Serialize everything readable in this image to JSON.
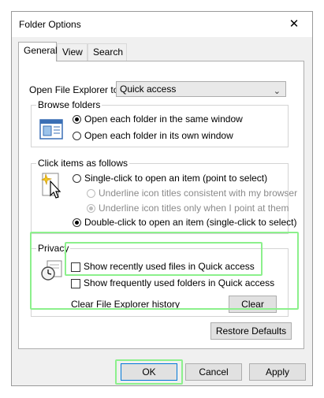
{
  "window": {
    "title": "Folder Options",
    "close_glyph": "✕"
  },
  "tabs": [
    {
      "label": "General",
      "active": true
    },
    {
      "label": "View",
      "active": false
    },
    {
      "label": "Search",
      "active": false
    }
  ],
  "open_file_explorer": {
    "label": "Open File Explorer to:",
    "selected": "Quick access"
  },
  "browse_folders": {
    "title": "Browse folders",
    "options": [
      {
        "label": "Open each folder in the same window",
        "checked": true
      },
      {
        "label": "Open each folder in its own window",
        "checked": false
      }
    ]
  },
  "click_items": {
    "title": "Click items as follows",
    "single_click": {
      "label": "Single-click to open an item (point to select)",
      "checked": false
    },
    "sub_options": [
      {
        "label": "Underline icon titles consistent with my browser",
        "checked": false,
        "enabled": false
      },
      {
        "label": "Underline icon titles only when I point at them",
        "checked": true,
        "enabled": false
      }
    ],
    "double_click": {
      "label": "Double-click to open an item (single-click to select)",
      "checked": true
    }
  },
  "privacy": {
    "title": "Privacy",
    "checkboxes": [
      {
        "label": "Show recently used files in Quick access",
        "checked": false
      },
      {
        "label": "Show frequently used folders in Quick access",
        "checked": false
      }
    ],
    "clear_label": "Clear File Explorer history",
    "clear_button": "Clear"
  },
  "restore_defaults": "Restore Defaults",
  "footer": {
    "ok": "OK",
    "cancel": "Cancel",
    "apply": "Apply"
  },
  "colors": {
    "highlight": "#8cf08c",
    "default_button_border": "#0078d7"
  },
  "icons": {
    "close": "close-icon",
    "dropdown": "chevron-down-icon",
    "browse": "folder-window-icon",
    "click": "cursor-click-icon",
    "privacy": "history-clock-icon"
  }
}
